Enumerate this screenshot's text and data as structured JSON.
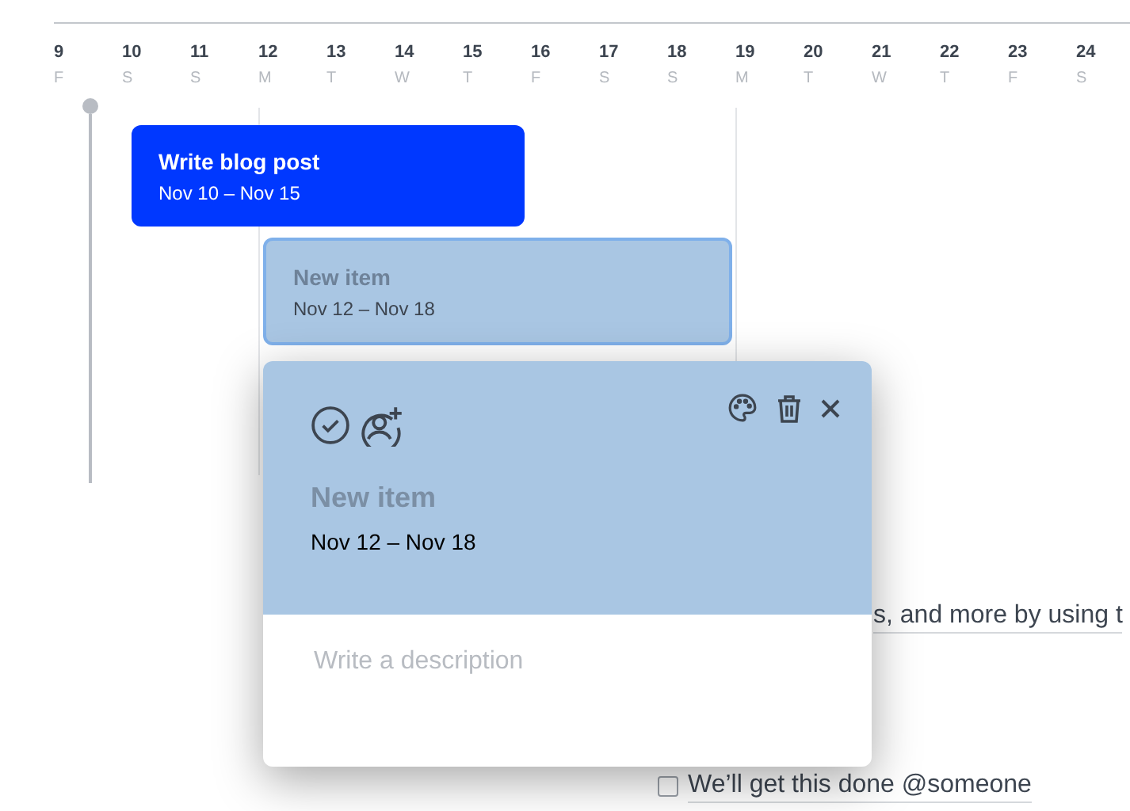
{
  "timeline": {
    "days": [
      {
        "number": "9",
        "weekday": "F"
      },
      {
        "number": "10",
        "weekday": "S"
      },
      {
        "number": "11",
        "weekday": "S"
      },
      {
        "number": "12",
        "weekday": "M"
      },
      {
        "number": "13",
        "weekday": "T"
      },
      {
        "number": "14",
        "weekday": "W"
      },
      {
        "number": "15",
        "weekday": "T"
      },
      {
        "number": "16",
        "weekday": "F"
      },
      {
        "number": "17",
        "weekday": "S"
      },
      {
        "number": "18",
        "weekday": "S"
      },
      {
        "number": "19",
        "weekday": "M"
      },
      {
        "number": "20",
        "weekday": "T"
      },
      {
        "number": "21",
        "weekday": "W"
      },
      {
        "number": "22",
        "weekday": "T"
      },
      {
        "number": "23",
        "weekday": "F"
      },
      {
        "number": "24",
        "weekday": "S"
      }
    ]
  },
  "items": [
    {
      "title": "Write blog post",
      "dates": "Nov 10 – Nov 15",
      "color": "#0038ff",
      "selected": false
    },
    {
      "title": "New item",
      "dates": "Nov 12 – Nov 18",
      "color": "#a9c6e3",
      "selected": true
    }
  ],
  "popup": {
    "title": "New item",
    "dates": "Nov 12 – Nov 18",
    "description": {
      "placeholder": "Write a description"
    }
  },
  "background_text": [
    {
      "kind": "text",
      "text": "s, and more by using t"
    },
    {
      "kind": "task",
      "text": "We’ll get this done @someone",
      "checked": false
    }
  ]
}
